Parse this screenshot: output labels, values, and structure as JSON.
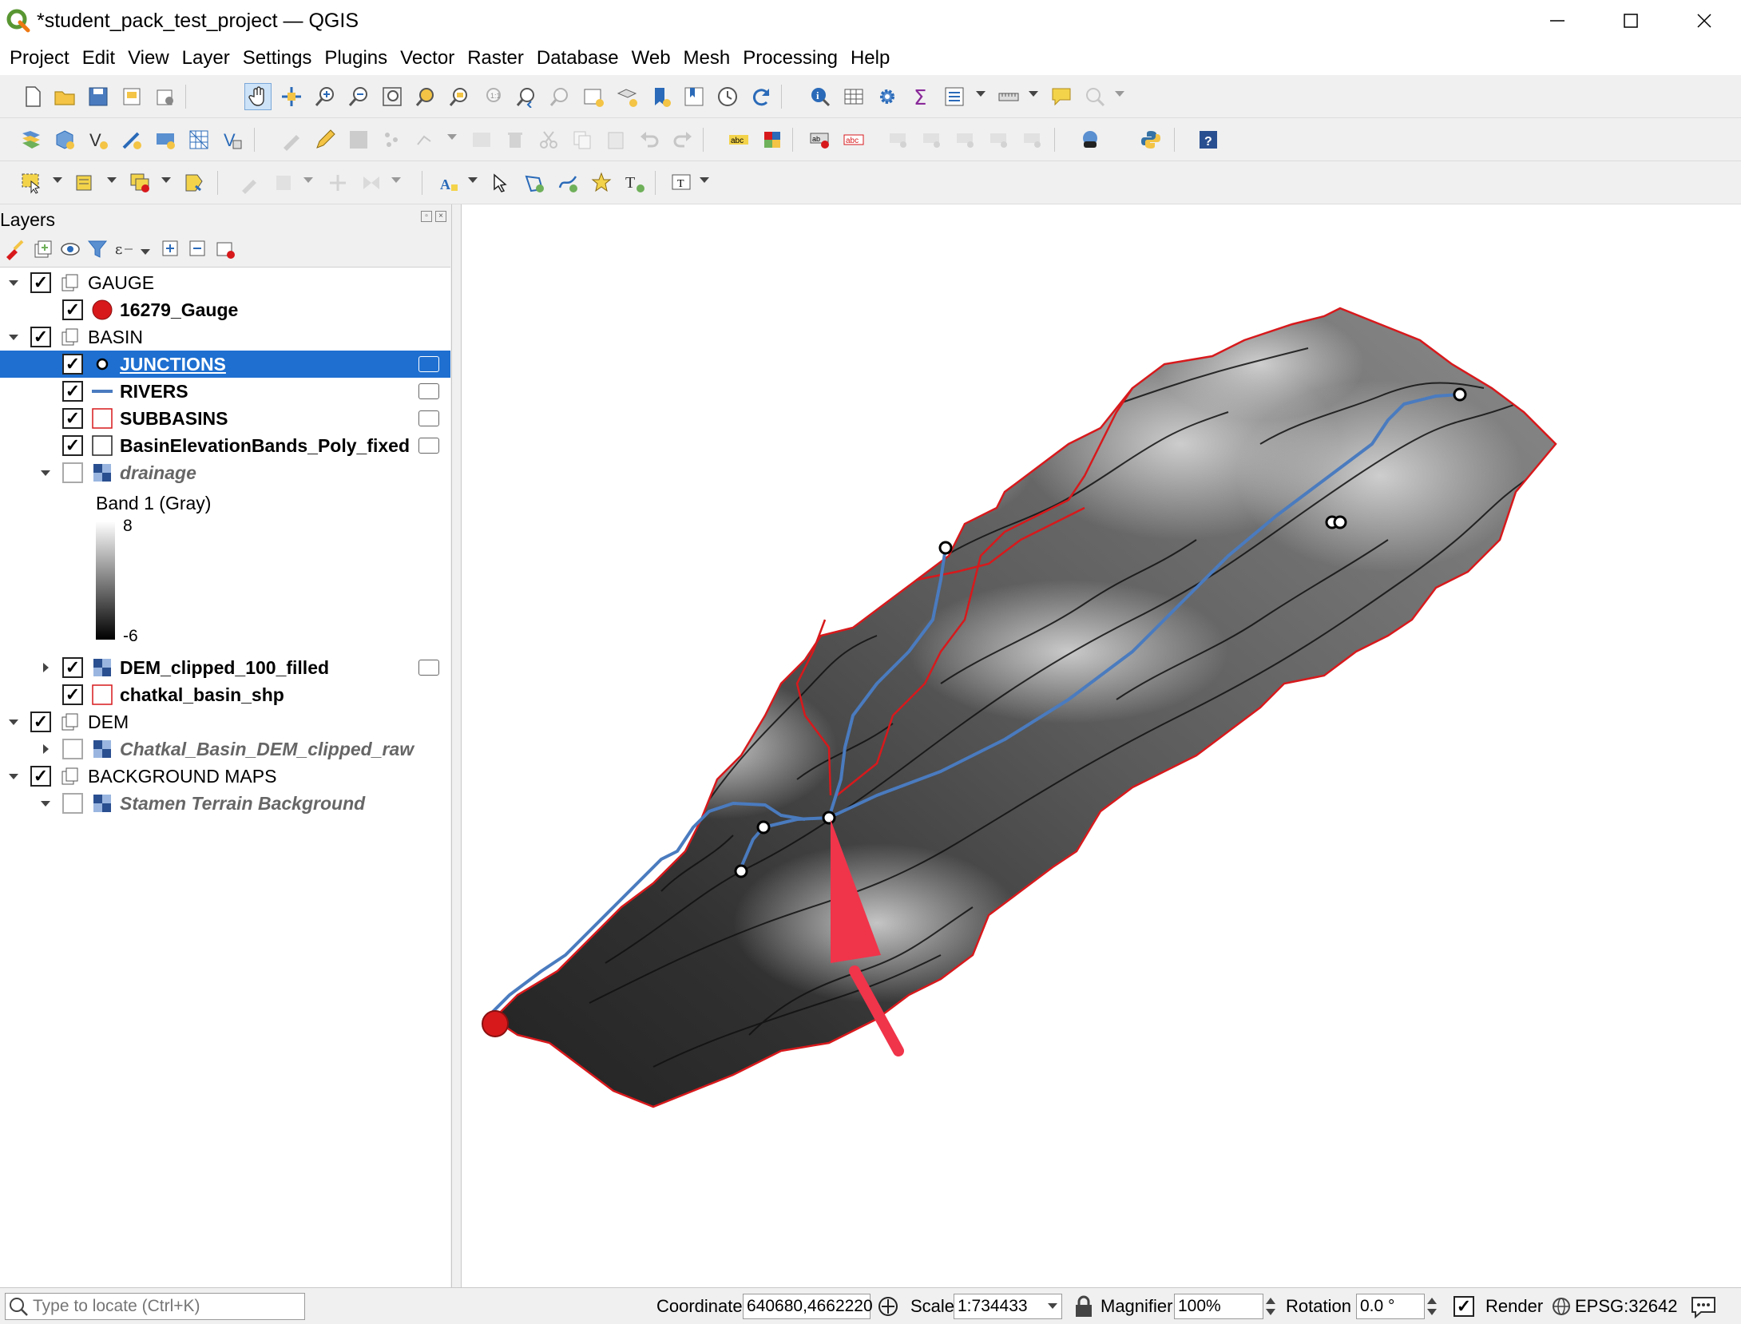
{
  "window": {
    "title": "*student_pack_test_project — QGIS",
    "controls": [
      "minimize",
      "maximize",
      "close"
    ]
  },
  "menu": [
    "Project",
    "Edit",
    "View",
    "Layer",
    "Settings",
    "Plugins",
    "Vector",
    "Raster",
    "Database",
    "Web",
    "Mesh",
    "Processing",
    "Help"
  ],
  "layers_panel": {
    "title": "Layers",
    "tree": [
      {
        "label": "GAUGE",
        "kind": "group",
        "checked": true,
        "expanded": true
      },
      {
        "label": "16279_Gauge",
        "kind": "point-layer",
        "checked": true,
        "symbol_color": "#d7191c"
      },
      {
        "label": "BASIN",
        "kind": "group",
        "checked": true,
        "expanded": true
      },
      {
        "label": "JUNCTIONS",
        "kind": "point-layer",
        "checked": true,
        "selected": true
      },
      {
        "label": "RIVERS",
        "kind": "line-layer",
        "checked": true,
        "symbol_color": "#4a7bbf"
      },
      {
        "label": "SUBBASINS",
        "kind": "polygon-layer",
        "checked": true,
        "symbol_color": "#d7191c"
      },
      {
        "label": "BasinElevationBands_Poly_fixed",
        "kind": "polygon-layer",
        "checked": true
      },
      {
        "label": "drainage",
        "kind": "raster-layer",
        "checked": false,
        "expanded": true
      },
      {
        "label": "DEM_clipped_100_filled",
        "kind": "raster-layer",
        "checked": true
      },
      {
        "label": "chatkal_basin_shp",
        "kind": "polygon-layer",
        "checked": true,
        "symbol_color": "#d7191c"
      },
      {
        "label": "DEM",
        "kind": "group",
        "checked": true,
        "expanded": true
      },
      {
        "label": "Chatkal_Basin_DEM_clipped_raw",
        "kind": "raster-layer",
        "checked": false
      },
      {
        "label": "BACKGROUND MAPS",
        "kind": "group",
        "checked": true,
        "expanded": true
      },
      {
        "label": "Stamen Terrain Background",
        "kind": "raster-layer",
        "checked": false
      }
    ],
    "legend": {
      "band": "Band 1 (Gray)",
      "max": "8",
      "min": "-6"
    }
  },
  "statusbar": {
    "locate_placeholder": "Type to locate (Ctrl+K)",
    "coordinate_label": "Coordinate",
    "coordinate_value": "640680,4662220",
    "scale_label": "Scale",
    "scale_value": "1:734433",
    "magnifier_label": "Magnifier",
    "magnifier_value": "100%",
    "rotation_label": "Rotation",
    "rotation_value": "0.0 °",
    "render_label": "Render",
    "render_checked": true,
    "crs": "EPSG:32642"
  },
  "colors": {
    "selection": "#1e6fd0",
    "river": "#4a7bbf",
    "boundary": "#d7191c",
    "arrow": "#f0344a"
  }
}
